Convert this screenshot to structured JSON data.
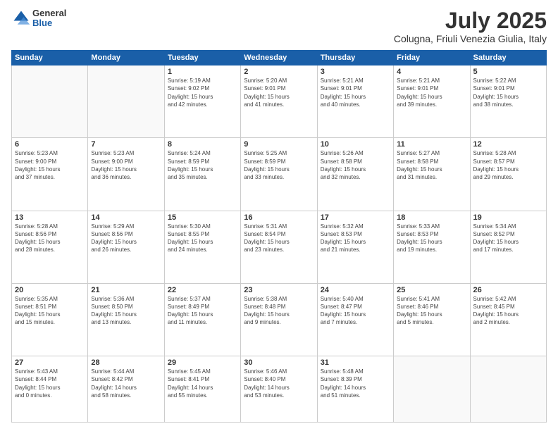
{
  "header": {
    "logo": {
      "general": "General",
      "blue": "Blue"
    },
    "title": "July 2025",
    "subtitle": "Colugna, Friuli Venezia Giulia, Italy"
  },
  "weekdays": [
    "Sunday",
    "Monday",
    "Tuesday",
    "Wednesday",
    "Thursday",
    "Friday",
    "Saturday"
  ],
  "weeks": [
    [
      {
        "day": "",
        "info": ""
      },
      {
        "day": "",
        "info": ""
      },
      {
        "day": "1",
        "info": "Sunrise: 5:19 AM\nSunset: 9:02 PM\nDaylight: 15 hours\nand 42 minutes."
      },
      {
        "day": "2",
        "info": "Sunrise: 5:20 AM\nSunset: 9:01 PM\nDaylight: 15 hours\nand 41 minutes."
      },
      {
        "day": "3",
        "info": "Sunrise: 5:21 AM\nSunset: 9:01 PM\nDaylight: 15 hours\nand 40 minutes."
      },
      {
        "day": "4",
        "info": "Sunrise: 5:21 AM\nSunset: 9:01 PM\nDaylight: 15 hours\nand 39 minutes."
      },
      {
        "day": "5",
        "info": "Sunrise: 5:22 AM\nSunset: 9:01 PM\nDaylight: 15 hours\nand 38 minutes."
      }
    ],
    [
      {
        "day": "6",
        "info": "Sunrise: 5:23 AM\nSunset: 9:00 PM\nDaylight: 15 hours\nand 37 minutes."
      },
      {
        "day": "7",
        "info": "Sunrise: 5:23 AM\nSunset: 9:00 PM\nDaylight: 15 hours\nand 36 minutes."
      },
      {
        "day": "8",
        "info": "Sunrise: 5:24 AM\nSunset: 8:59 PM\nDaylight: 15 hours\nand 35 minutes."
      },
      {
        "day": "9",
        "info": "Sunrise: 5:25 AM\nSunset: 8:59 PM\nDaylight: 15 hours\nand 33 minutes."
      },
      {
        "day": "10",
        "info": "Sunrise: 5:26 AM\nSunset: 8:58 PM\nDaylight: 15 hours\nand 32 minutes."
      },
      {
        "day": "11",
        "info": "Sunrise: 5:27 AM\nSunset: 8:58 PM\nDaylight: 15 hours\nand 31 minutes."
      },
      {
        "day": "12",
        "info": "Sunrise: 5:28 AM\nSunset: 8:57 PM\nDaylight: 15 hours\nand 29 minutes."
      }
    ],
    [
      {
        "day": "13",
        "info": "Sunrise: 5:28 AM\nSunset: 8:56 PM\nDaylight: 15 hours\nand 28 minutes."
      },
      {
        "day": "14",
        "info": "Sunrise: 5:29 AM\nSunset: 8:56 PM\nDaylight: 15 hours\nand 26 minutes."
      },
      {
        "day": "15",
        "info": "Sunrise: 5:30 AM\nSunset: 8:55 PM\nDaylight: 15 hours\nand 24 minutes."
      },
      {
        "day": "16",
        "info": "Sunrise: 5:31 AM\nSunset: 8:54 PM\nDaylight: 15 hours\nand 23 minutes."
      },
      {
        "day": "17",
        "info": "Sunrise: 5:32 AM\nSunset: 8:53 PM\nDaylight: 15 hours\nand 21 minutes."
      },
      {
        "day": "18",
        "info": "Sunrise: 5:33 AM\nSunset: 8:53 PM\nDaylight: 15 hours\nand 19 minutes."
      },
      {
        "day": "19",
        "info": "Sunrise: 5:34 AM\nSunset: 8:52 PM\nDaylight: 15 hours\nand 17 minutes."
      }
    ],
    [
      {
        "day": "20",
        "info": "Sunrise: 5:35 AM\nSunset: 8:51 PM\nDaylight: 15 hours\nand 15 minutes."
      },
      {
        "day": "21",
        "info": "Sunrise: 5:36 AM\nSunset: 8:50 PM\nDaylight: 15 hours\nand 13 minutes."
      },
      {
        "day": "22",
        "info": "Sunrise: 5:37 AM\nSunset: 8:49 PM\nDaylight: 15 hours\nand 11 minutes."
      },
      {
        "day": "23",
        "info": "Sunrise: 5:38 AM\nSunset: 8:48 PM\nDaylight: 15 hours\nand 9 minutes."
      },
      {
        "day": "24",
        "info": "Sunrise: 5:40 AM\nSunset: 8:47 PM\nDaylight: 15 hours\nand 7 minutes."
      },
      {
        "day": "25",
        "info": "Sunrise: 5:41 AM\nSunset: 8:46 PM\nDaylight: 15 hours\nand 5 minutes."
      },
      {
        "day": "26",
        "info": "Sunrise: 5:42 AM\nSunset: 8:45 PM\nDaylight: 15 hours\nand 2 minutes."
      }
    ],
    [
      {
        "day": "27",
        "info": "Sunrise: 5:43 AM\nSunset: 8:44 PM\nDaylight: 15 hours\nand 0 minutes."
      },
      {
        "day": "28",
        "info": "Sunrise: 5:44 AM\nSunset: 8:42 PM\nDaylight: 14 hours\nand 58 minutes."
      },
      {
        "day": "29",
        "info": "Sunrise: 5:45 AM\nSunset: 8:41 PM\nDaylight: 14 hours\nand 55 minutes."
      },
      {
        "day": "30",
        "info": "Sunrise: 5:46 AM\nSunset: 8:40 PM\nDaylight: 14 hours\nand 53 minutes."
      },
      {
        "day": "31",
        "info": "Sunrise: 5:48 AM\nSunset: 8:39 PM\nDaylight: 14 hours\nand 51 minutes."
      },
      {
        "day": "",
        "info": ""
      },
      {
        "day": "",
        "info": ""
      }
    ]
  ]
}
